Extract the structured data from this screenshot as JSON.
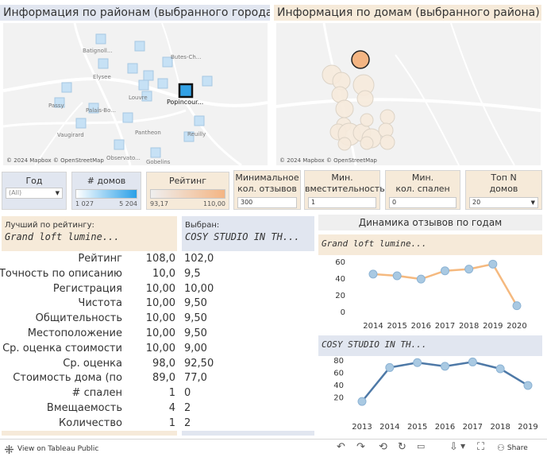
{
  "headers": {
    "districts": "Информация  по районам (выбранного города)",
    "houses": "Информация по домам (выбранного района)"
  },
  "map_left": {
    "labels": [
      "Batignoll...",
      "Butes-Ch...",
      "Elysee",
      "Louvre",
      "Popincour...",
      "Passy",
      "Palais-Bo...",
      "Vaugirard",
      "Pantheon",
      "Reuilly",
      "Observato...",
      "Gobelins"
    ],
    "credit": "© 2024 Mapbox  © OpenStreetMap"
  },
  "map_right": {
    "credit": "© 2024 Mapbox  © OpenStreetMap"
  },
  "filters": {
    "year": {
      "title": "Год",
      "value": "(All)"
    },
    "houses_count": {
      "title": "# домов",
      "min": "1 027",
      "max": "5 204"
    },
    "rating": {
      "title": "Рейтинг",
      "min": "93,17",
      "max": "110,00"
    },
    "min_reviews": {
      "title_line1": "Минимальное",
      "title_line2": "кол. отзывов",
      "value": "300"
    },
    "min_capacity": {
      "title_line1": "Мин.",
      "title_line2": "вместительность",
      "value": "1"
    },
    "min_bedrooms": {
      "title_line1": "Мин.",
      "title_line2": "кол. спален",
      "value": "0"
    },
    "top_n": {
      "title_line1": "Топ N",
      "title_line2": "домов",
      "value": "20"
    }
  },
  "best": {
    "label": "Лучший по рейтингу:",
    "name": "Grand loft lumine..."
  },
  "selected": {
    "label": "Выбран:",
    "name": "COSY STUDIO IN TH..."
  },
  "metrics": [
    {
      "label": "Рейтинг",
      "best": "108,0",
      "selected": "102,0"
    },
    {
      "label": "Точность по описанию",
      "best": "10,0",
      "selected": "9,5"
    },
    {
      "label": "Регистрация",
      "best": "10,00",
      "selected": "10,00"
    },
    {
      "label": "Чистота",
      "best": "10,00",
      "selected": "9,50"
    },
    {
      "label": "Общительность",
      "best": "10,00",
      "selected": "9,50"
    },
    {
      "label": "Местоположение",
      "best": "10,00",
      "selected": "9,50"
    },
    {
      "label": "Ср. оценка стоимости",
      "best": "10,00",
      "selected": "9,00"
    },
    {
      "label": "Ср. оценка",
      "best": "98,0",
      "selected": "92,50"
    },
    {
      "label": "Стоимость дома (по",
      "best": "89,0",
      "selected": "77,0"
    },
    {
      "label": "# спален",
      "best": "1",
      "selected": "0"
    },
    {
      "label": "Вмещаемость",
      "best": "4",
      "selected": "2"
    },
    {
      "label": "Количество",
      "best": "1",
      "selected": "2"
    }
  ],
  "dynamics_title": "Динамика отзывов по годам",
  "chart_data": [
    {
      "type": "line",
      "title": "Grand loft lumine...",
      "x": [
        2014,
        2015,
        2016,
        2017,
        2018,
        2019,
        2020
      ],
      "y": [
        46,
        44,
        40,
        50,
        52,
        58,
        8
      ],
      "y_ticks": [
        0,
        20,
        40,
        60
      ],
      "ylim": [
        0,
        65
      ],
      "color": "#f5b97f",
      "point_color": "#a9c9e2"
    },
    {
      "type": "line",
      "title": "COSY STUDIO IN TH...",
      "x": [
        2013,
        2014,
        2015,
        2016,
        2017,
        2018,
        2019
      ],
      "y": [
        14,
        69,
        77,
        71,
        78,
        67,
        40
      ],
      "y_ticks": [
        20,
        40,
        60,
        80
      ],
      "ylim": [
        0,
        85
      ],
      "color": "#4e79a7",
      "point_color": "#a9c9e2"
    }
  ],
  "toolbar": {
    "view_label": "View on Tableau Public",
    "share_label": "Share"
  },
  "colors": {
    "blue_light": "#e1e6f0",
    "orange_light": "#f6ead9",
    "accent_blue": "#33a2e6",
    "accent_orange": "#f4b583"
  }
}
